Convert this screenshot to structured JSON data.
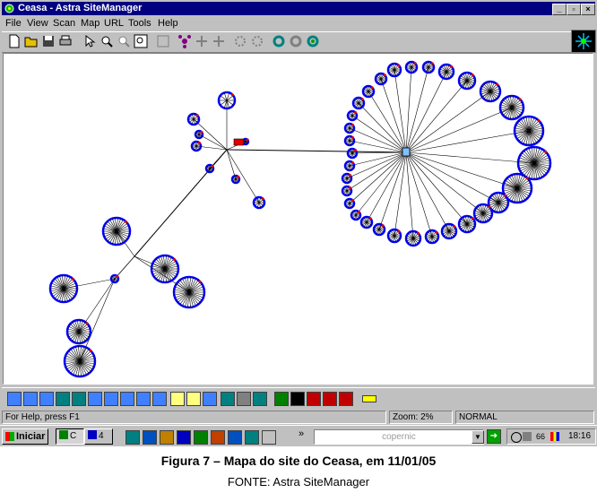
{
  "window": {
    "title": "Ceasa - Astra SiteManager"
  },
  "menu": [
    "File",
    "View",
    "Scan",
    "Map",
    "URL",
    "Tools",
    "Help"
  ],
  "icons": {
    "toolbar": [
      "new-file-icon",
      "open-folder-icon",
      "save-icon",
      "print-icon",
      "pointer-icon",
      "zoom-in-icon",
      "zoom-out-icon",
      "zoom-fit-icon",
      "map-view-icon",
      "cluster-icon",
      "expand-icon",
      "collapse-icon",
      "settings-icon",
      "gear-icon",
      "refresh-icon",
      "stop-scan-icon",
      "scan-icon"
    ],
    "bottom": [
      "page-icon",
      "page-icon",
      "html-icon",
      "image-icon",
      "media-icon",
      "sound-icon",
      "script-icon",
      "link-icon",
      "doc-icon",
      "cgi-icon",
      "folder-icon",
      "file-icon",
      "broken-link-icon",
      "mail-icon",
      "ftp-icon",
      "filter-icon",
      "status-ok-icon",
      "status-warning-icon",
      "status-error-icon",
      "status-broken-icon",
      "status-missing-icon",
      "status-other-icon"
    ]
  },
  "status": {
    "help": "For Help, press F1",
    "zoom": "Zoom: 2%",
    "mode": "NORMAL"
  },
  "taskbar": {
    "start": "Iniciar",
    "tasks": [
      "C",
      "4"
    ],
    "more": "»",
    "search_text": "copernic",
    "tray_count": "66",
    "clock": "18:16"
  },
  "figure": {
    "caption": "Figura 7 – Mapa do site do Ceasa, em 11/01/05",
    "source": "FONTE: Astra SiteManager"
  },
  "colors": {
    "titlebar": "#000080",
    "node": "#0000ff",
    "marker": "#e00000"
  }
}
